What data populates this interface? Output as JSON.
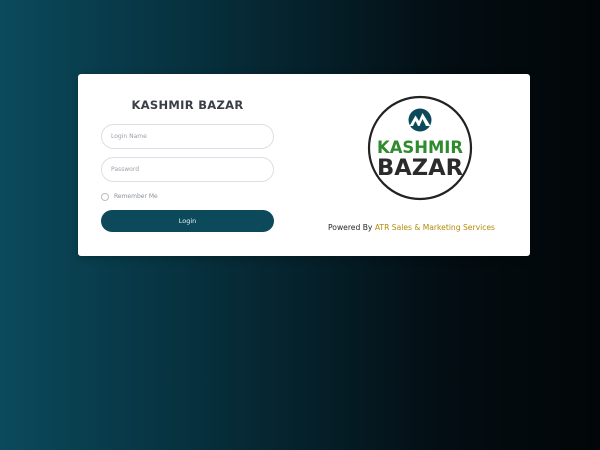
{
  "app": {
    "title": "KASHMIR BAZAR"
  },
  "form": {
    "login_placeholder": "Login Name",
    "password_placeholder": "Password",
    "remember_label": "Remember Me",
    "login_button": "Login"
  },
  "logo": {
    "line1": "KASHMIR",
    "line2": "BAZAR",
    "icon": "mountain-icon"
  },
  "footer": {
    "powered_prefix": "Powered By",
    "company": "ATR Sales & Marketing Services"
  },
  "colors": {
    "primary": "#0c4a5b",
    "logo_green": "#2e8b2e",
    "logo_dark": "#2b2b2b",
    "company_gold": "#b38a07",
    "background_start": "#0a4a5c",
    "background_end": "#020608"
  }
}
